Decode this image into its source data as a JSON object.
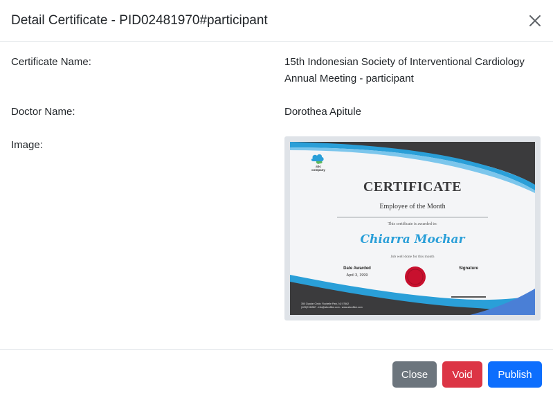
{
  "modal": {
    "title": "Detail Certificate - PID02481970#participant"
  },
  "fields": {
    "certificate_name_label": "Certificate Name:",
    "certificate_name_value_line1": "15th Indonesian Society of Interventional Cardiology",
    "certificate_name_value_line2": "Annual Meeting - participant",
    "doctor_name_label": "Doctor Name:",
    "doctor_name_value": "Dorothea Apitule",
    "image_label": "Image:"
  },
  "certificate_image": {
    "logo_line1": "abc",
    "logo_line2": "company",
    "heading": "CERTIFICATE",
    "subheading": "Employee of the Month",
    "awarded_to_text": "This certificate is awarded to:",
    "recipient": "Chiarra Mochar",
    "remark": "Job well done for this month",
    "date_label": "Date Awarded",
    "date_value": "April 3, 1999",
    "signature_label": "Signature",
    "footer_line1": "350 Ciyalon Circle, Rochelle Park, NJ 07662",
    "footer_line2": "(123)2134567 - info@abcoffice.com - www.abcoffice.com",
    "colors": {
      "accent_blue": "#2a9fd8",
      "dark_band": "#3b3b3d",
      "seal_red": "#c8102e"
    }
  },
  "footer": {
    "close_label": "Close",
    "void_label": "Void",
    "publish_label": "Publish"
  },
  "icons": {
    "close": "close-icon"
  }
}
